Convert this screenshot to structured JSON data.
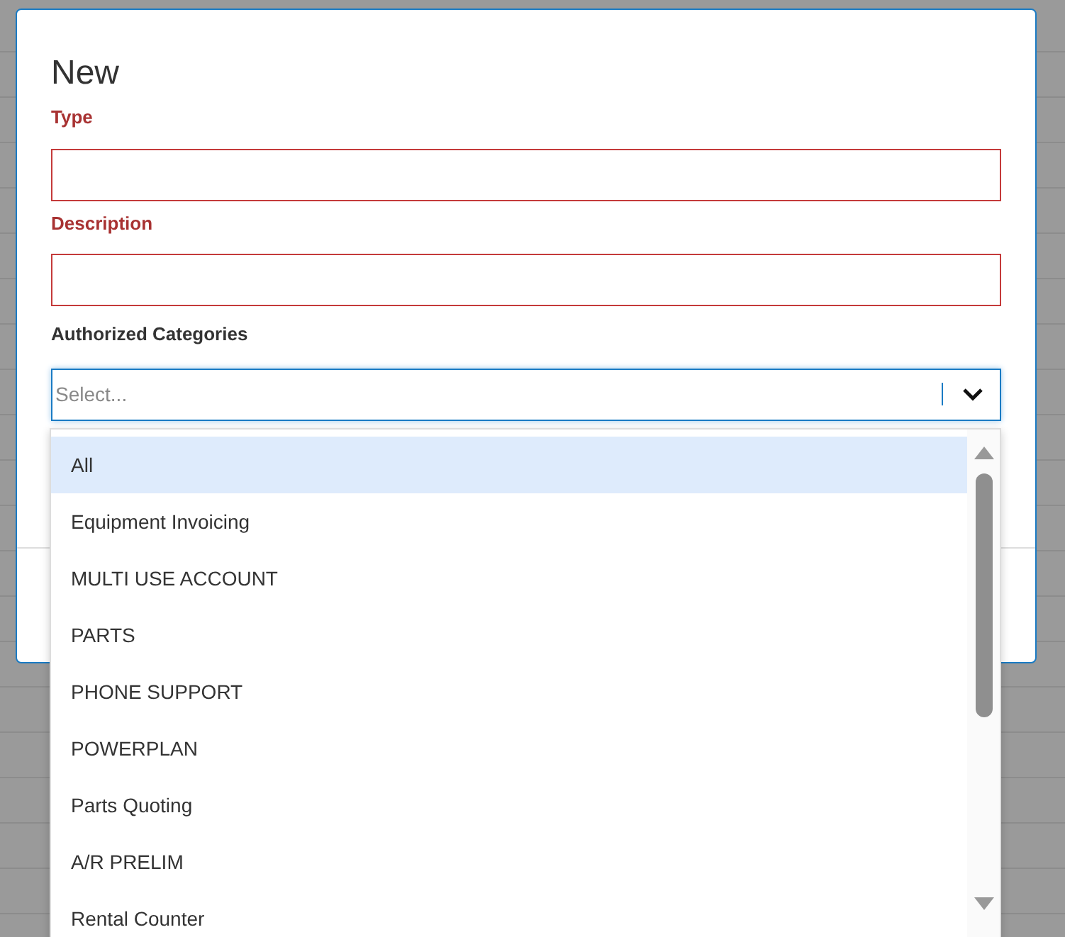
{
  "dialog": {
    "title": "New",
    "fields": [
      {
        "label": "Type",
        "required": true
      },
      {
        "label": "Description",
        "required": true
      }
    ],
    "select": {
      "label": "Authorized Categories",
      "placeholder": "Select...",
      "expanded": true
    },
    "options": [
      {
        "label": "All",
        "selected": true
      },
      {
        "label": "Equipment Invoicing",
        "selected": false
      },
      {
        "label": "MULTI USE ACCOUNT",
        "selected": false
      },
      {
        "label": "PARTS",
        "selected": false
      },
      {
        "label": "PHONE SUPPORT",
        "selected": false
      },
      {
        "label": "POWERPLAN",
        "selected": false
      },
      {
        "label": "Parts Quoting",
        "selected": false
      },
      {
        "label": "A/R PRELIM",
        "selected": false
      },
      {
        "label": "Rental Counter",
        "selected": false
      }
    ]
  }
}
